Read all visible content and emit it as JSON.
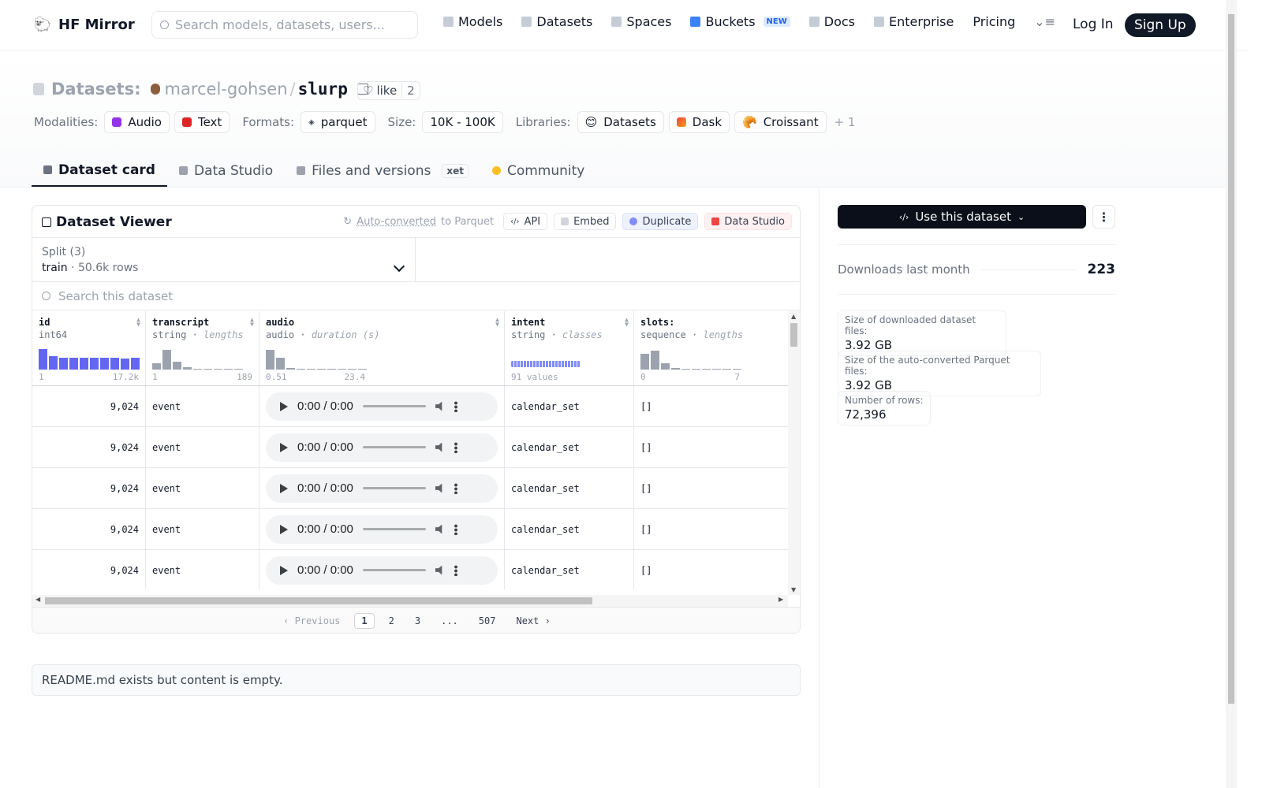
{
  "nav": {
    "brand": "HF Mirror",
    "search_placeholder": "Search models, datasets, users...",
    "links": [
      "Models",
      "Datasets",
      "Spaces",
      "Buckets",
      "Docs",
      "Enterprise",
      "Pricing"
    ],
    "new_badge": "NEW",
    "login": "Log In",
    "signup": "Sign Up"
  },
  "header": {
    "section": "Datasets:",
    "owner": "marcel-gohsen",
    "slash": "/",
    "repo": "slurp",
    "like_label": "like",
    "like_count": "2",
    "modalities_label": "Modalities:",
    "modalities": [
      "Audio",
      "Text"
    ],
    "formats_label": "Formats:",
    "formats": [
      "parquet"
    ],
    "size_label": "Size:",
    "size": "10K - 100K",
    "libraries_label": "Libraries:",
    "libraries": [
      "Datasets",
      "Dask",
      "Croissant"
    ],
    "more_libraries": "+ 1"
  },
  "tabs": {
    "card": "Dataset card",
    "studio": "Data Studio",
    "files": "Files and versions",
    "xet": "xet",
    "community": "Community"
  },
  "viewer": {
    "title": "Dataset Viewer",
    "auto_prefix": "Auto-converted",
    "auto_suffix": "to Parquet",
    "api": "API",
    "embed": "Embed",
    "duplicate": "Duplicate",
    "data_studio": "Data Studio",
    "split_label": "Split (3)",
    "split_name": "train",
    "split_rows": "50.6k rows",
    "search_placeholder": "Search this dataset",
    "columns": [
      {
        "name": "id",
        "type": "int64",
        "stat": "",
        "min": "1",
        "max": "17.2k"
      },
      {
        "name": "transcript",
        "type": "string",
        "stat": "lengths",
        "min": "1",
        "max": "189"
      },
      {
        "name": "audio",
        "type": "audio",
        "stat": "duration (s)",
        "min": "0.51",
        "max": "23.4"
      },
      {
        "name": "intent",
        "type": "string",
        "stat": "classes",
        "min": "91 values",
        "max": ""
      },
      {
        "name": "slots:",
        "type": "sequence",
        "stat": "lengths",
        "min": "0",
        "max": "7"
      }
    ],
    "rows": [
      {
        "id": "9,024",
        "transcript": "event",
        "time": "0:00 / 0:00",
        "intent": "calendar_set",
        "slots": "[]"
      },
      {
        "id": "9,024",
        "transcript": "event",
        "time": "0:00 / 0:00",
        "intent": "calendar_set",
        "slots": "[]"
      },
      {
        "id": "9,024",
        "transcript": "event",
        "time": "0:00 / 0:00",
        "intent": "calendar_set",
        "slots": "[]"
      },
      {
        "id": "9,024",
        "transcript": "event",
        "time": "0:00 / 0:00",
        "intent": "calendar_set",
        "slots": "[]"
      },
      {
        "id": "9,024",
        "transcript": "event",
        "time": "0:00 / 0:00",
        "intent": "calendar_set",
        "slots": "[]"
      }
    ],
    "pager": {
      "prev": "‹ Previous",
      "pages": [
        "1",
        "2",
        "3",
        "...",
        "507"
      ],
      "next": "Next ›",
      "current": "1"
    }
  },
  "readme": "README.md exists but content is empty.",
  "sidebar": {
    "use_button": "Use this dataset",
    "downloads_label": "Downloads last month",
    "downloads": "223",
    "stats": [
      {
        "label": "Size of downloaded dataset files:",
        "value": "3.92 GB"
      },
      {
        "label": "Size of the auto-converted Parquet files:",
        "value": "3.92 GB"
      },
      {
        "label": "Number of rows:",
        "value": "72,396"
      }
    ]
  }
}
